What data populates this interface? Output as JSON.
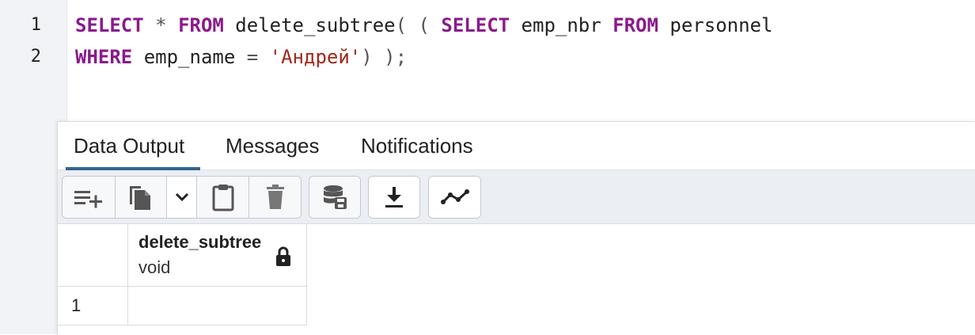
{
  "editor": {
    "line_numbers": [
      "1",
      "2"
    ],
    "lines": [
      {
        "tokens": [
          {
            "type": "kw",
            "text": "SELECT"
          },
          {
            "type": "op",
            "text": " * "
          },
          {
            "type": "kw",
            "text": "FROM"
          },
          {
            "type": "plain",
            "text": " delete_subtree"
          },
          {
            "type": "op",
            "text": "( ( "
          },
          {
            "type": "kw",
            "text": "SELECT"
          },
          {
            "type": "plain",
            "text": " emp_nbr "
          },
          {
            "type": "kw",
            "text": "FROM"
          },
          {
            "type": "plain",
            "text": " personnel"
          }
        ]
      },
      {
        "tokens": [
          {
            "type": "kw",
            "text": "WHERE"
          },
          {
            "type": "plain",
            "text": " emp_name "
          },
          {
            "type": "op",
            "text": "= "
          },
          {
            "type": "str",
            "text": "'Андрей'"
          },
          {
            "type": "op",
            "text": ") );"
          }
        ]
      }
    ]
  },
  "tabs": [
    {
      "label": "Data Output",
      "active": true
    },
    {
      "label": "Messages",
      "active": false
    },
    {
      "label": "Notifications",
      "active": false
    }
  ],
  "toolbar": {
    "icons": [
      "add-row-icon",
      "copy-icon",
      "chevron-down-icon",
      "paste-icon",
      "delete-icon",
      "save-data-icon",
      "download-icon",
      "graph-icon"
    ]
  },
  "grid": {
    "column": {
      "name": "delete_subtree",
      "type": "void",
      "locked": true
    },
    "rows": [
      {
        "row_number": "1",
        "value": ""
      }
    ]
  },
  "colors": {
    "keyword": "#8a1a8c",
    "string": "#a3261c",
    "active_tab_underline": "#326690"
  }
}
